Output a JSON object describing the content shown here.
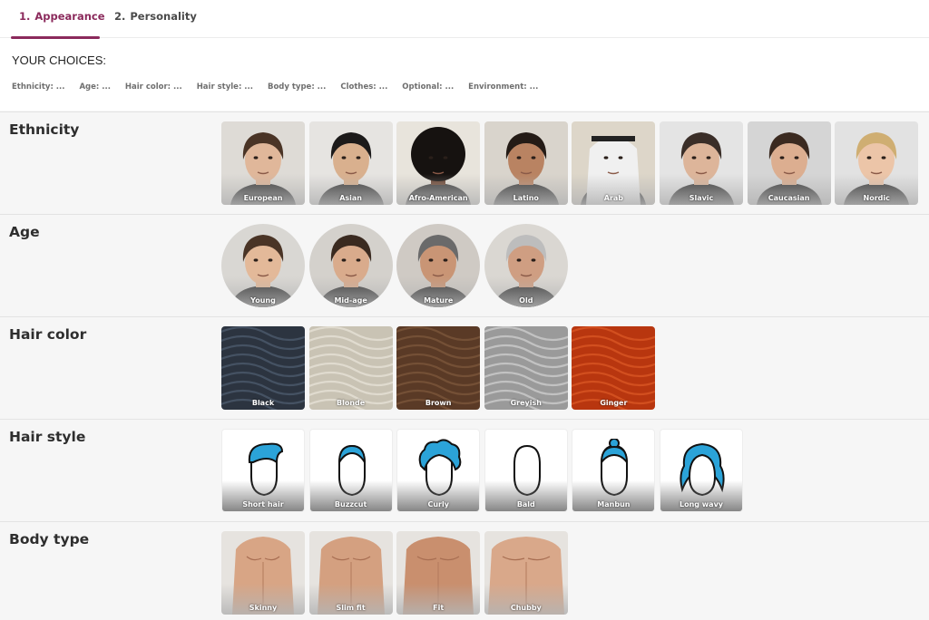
{
  "tabs": [
    {
      "num": "1.",
      "label": "Appearance",
      "active": true
    },
    {
      "num": "2.",
      "label": "Personality",
      "active": false
    }
  ],
  "choices": {
    "title": "YOUR CHOICES:",
    "items": [
      "Ethnicity: ...",
      "Age: ...",
      "Hair color: ...",
      "Hair style: ...",
      "Body type: ...",
      "Clothes: ...",
      "Optional: ...",
      "Environment: ..."
    ]
  },
  "sections": {
    "ethnicity": {
      "title": "Ethnicity",
      "options": [
        "European",
        "Asian",
        "Afro-American",
        "Latino",
        "Arab",
        "Slavic",
        "Caucasian",
        "Nordic"
      ]
    },
    "age": {
      "title": "Age",
      "options": [
        "Young",
        "Mid-age",
        "Mature",
        "Old"
      ]
    },
    "hair_color": {
      "title": "Hair color",
      "options": [
        "Black",
        "Blonde",
        "Brown",
        "Greyish",
        "Ginger"
      ]
    },
    "hair_style": {
      "title": "Hair style",
      "options": [
        "Short hair",
        "Buzzcut",
        "Curly",
        "Bald",
        "Manbun",
        "Long wavy"
      ]
    },
    "body_type": {
      "title": "Body type",
      "options": [
        "Skinny",
        "Slim fit",
        "Fit",
        "Chubby"
      ]
    }
  },
  "colors": {
    "accent": "#8b2a5c",
    "hair_icon_blue": "#2ba3d8",
    "swatch_black": "#2c3440",
    "swatch_blonde": "#c9c3b4",
    "swatch_brown": "#5a3a26",
    "swatch_greyish": "#9a9a9a",
    "swatch_ginger": "#b8360f"
  }
}
